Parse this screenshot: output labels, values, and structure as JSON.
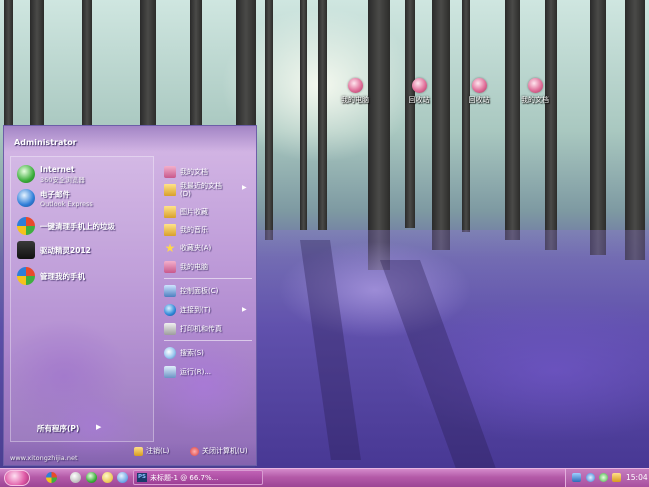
{
  "desktop": {
    "icons": [
      {
        "name": "my-documents-desktop-icon",
        "label": "我的电脑"
      },
      {
        "name": "recycle-bin-desktop-icon",
        "label": "回收站"
      },
      {
        "name": "network-desktop-icon",
        "label": "回收站"
      },
      {
        "name": "docs-desktop-icon",
        "label": "我的文档"
      }
    ]
  },
  "start_menu": {
    "user": "Administrator",
    "pinned": [
      {
        "title": "Internet",
        "subtitle": "360安全浏览器"
      },
      {
        "title": "电子邮件",
        "subtitle": "Outlook Express"
      },
      {
        "title": "一键清理手机上的垃圾",
        "subtitle": ""
      },
      {
        "title": "驱动精灵2012",
        "subtitle": ""
      },
      {
        "title": "管理我的手机",
        "subtitle": ""
      }
    ],
    "all_programs": "所有程序(P)",
    "right_items": {
      "my_docs": "我的文档",
      "recent_docs_1": "我最近的文档",
      "recent_docs_2": "(D)",
      "pictures": "图片收藏",
      "music": "我的音乐",
      "favorites": "收藏夹(A)",
      "my_computer": "我的电脑",
      "control_panel": "控制面板(C)",
      "connect_to": "连接到(T)",
      "printers": "打印机和传真",
      "search": "搜索(S)",
      "run": "运行(R)..."
    },
    "footer": {
      "url": "www.xitongzhijia.net",
      "logoff": "注销(L)",
      "shutdown": "关闭计算机(U)"
    }
  },
  "taskbar": {
    "task_label": "未标题-1 @ 66.7%...",
    "task_app_abbrev": "PS",
    "clock": "15:04"
  },
  "colors": {
    "taskbar": "#b45aa8",
    "start_menu_bg": "#c4a3dc"
  }
}
